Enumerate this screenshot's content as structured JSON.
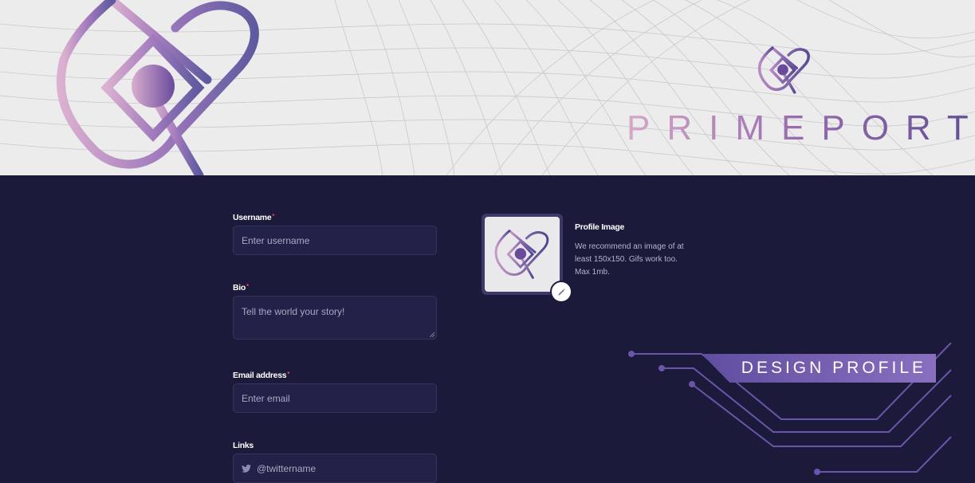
{
  "brand": {
    "name": "PRIMEPORT"
  },
  "form": {
    "username": {
      "label": "Username",
      "placeholder": "Enter username"
    },
    "bio": {
      "label": "Bio",
      "placeholder": "Tell the world your story!"
    },
    "email": {
      "label": "Email address",
      "placeholder": "Enter email"
    },
    "links": {
      "label": "Links",
      "twitter_placeholder": "@twittername"
    },
    "required_marker": "*"
  },
  "profile": {
    "title": "Profile Image",
    "description": "We recommend an image of at least 150x150. Gifs work too. Max 1mb."
  },
  "tag": {
    "text": "DESIGN PROFILE"
  },
  "colors": {
    "background": "#1b1a3a",
    "input_bg": "#222147",
    "accent_purple": "#7a5fb5",
    "accent_pink": "#d6a7c8",
    "required": "#e0455e"
  },
  "icons": [
    "prime-logo-icon",
    "pencil-icon",
    "twitter-icon"
  ]
}
